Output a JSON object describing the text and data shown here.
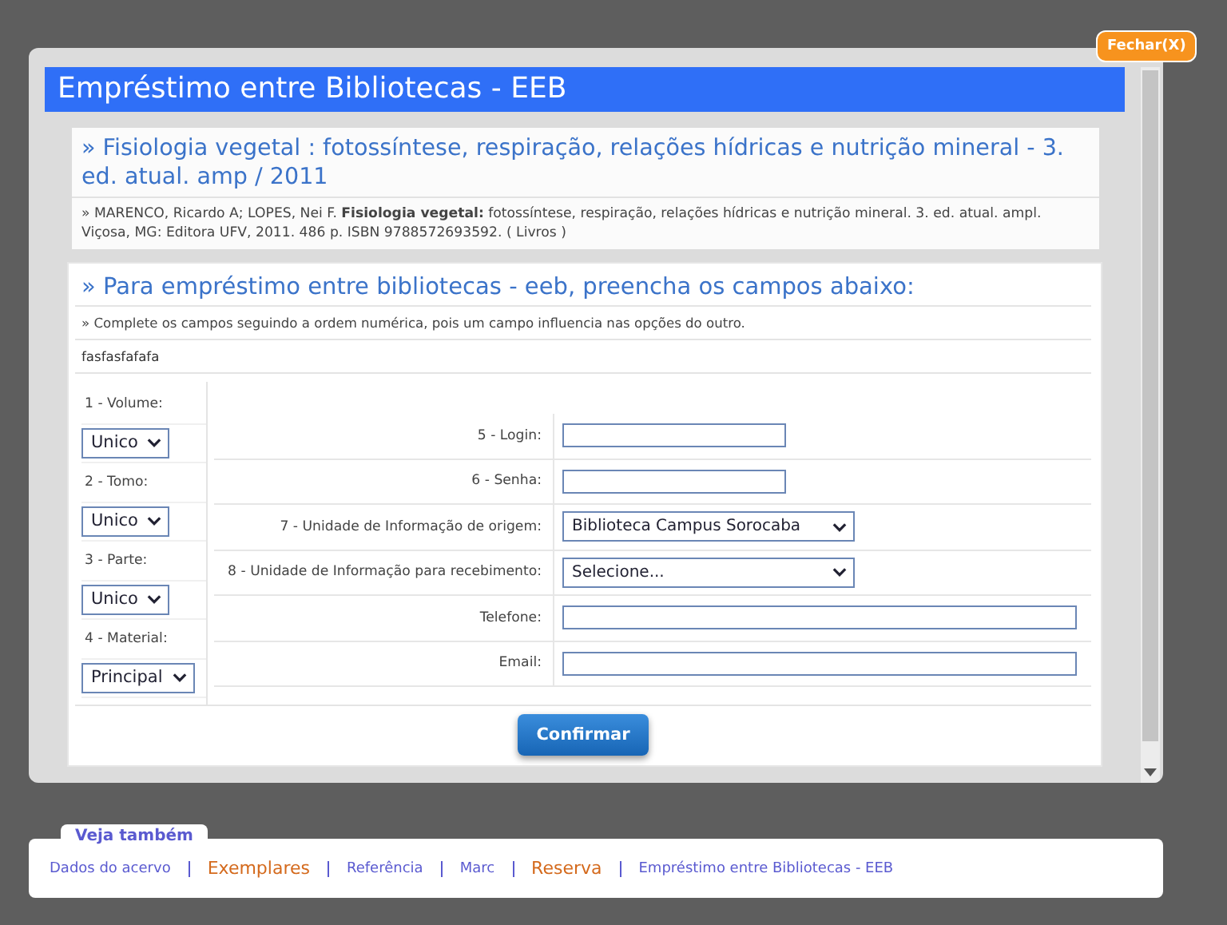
{
  "window": {
    "title": "Empréstimo entre Bibliotecas - EEB",
    "close_button": "Fechar(X)"
  },
  "book": {
    "title": "» Fisiologia vegetal : fotossíntese, respiração, relações hídricas e nutrição mineral - 3. ed. atual. amp / 2011",
    "reference": "» MARENCO, Ricardo A; LOPES, Nei F. **Fisiologia vegetal:** fotossíntese, respiração, relações hídricas e nutrição mineral. 3. ed. atual. ampl. Viçosa, MG: Editora UFV, 2011. 486 p. ISBN 9788572693592. ( Livros )"
  },
  "form": {
    "heading": "» Para empréstimo entre bibliotecas - eeb, preencha os campos abaixo:",
    "instruction": "» Complete os campos seguindo a ordem numérica, pois um campo influencia nas opções do outro.",
    "note": "fasfasfafafa",
    "left_fields": [
      {
        "label": "1 - Volume:",
        "value": "Unico"
      },
      {
        "label": "2 - Tomo:",
        "value": "Unico"
      },
      {
        "label": "3 - Parte:",
        "value": "Unico"
      },
      {
        "label": "4 - Material:",
        "value": "Principal"
      }
    ],
    "right_fields": [
      {
        "label": "5 - Login:",
        "kind": "short_text"
      },
      {
        "label": "6 - Senha:",
        "kind": "short_text"
      },
      {
        "label": "7 - Unidade de Informação de origem:",
        "kind": "select",
        "value": "Biblioteca Campus Sorocaba"
      },
      {
        "label": "8 - Unidade de Informação para recebimento:",
        "kind": "select",
        "value": "Selecione..."
      },
      {
        "label": "Telefone:",
        "kind": "long_text"
      },
      {
        "label": "Email:",
        "kind": "long_text"
      }
    ],
    "confirm_button": "Confirmar"
  },
  "footer": {
    "tab": "Veja também",
    "links": [
      {
        "label": "Dados do acervo",
        "kind": "normal"
      },
      {
        "label": "Exemplares",
        "kind": "highlight"
      },
      {
        "label": "Referência",
        "kind": "normal"
      },
      {
        "label": "Marc",
        "kind": "normal"
      },
      {
        "label": "Reserva",
        "kind": "highlight"
      },
      {
        "label": "Empréstimo entre Bibliotecas - EEB",
        "kind": "normal"
      }
    ]
  }
}
